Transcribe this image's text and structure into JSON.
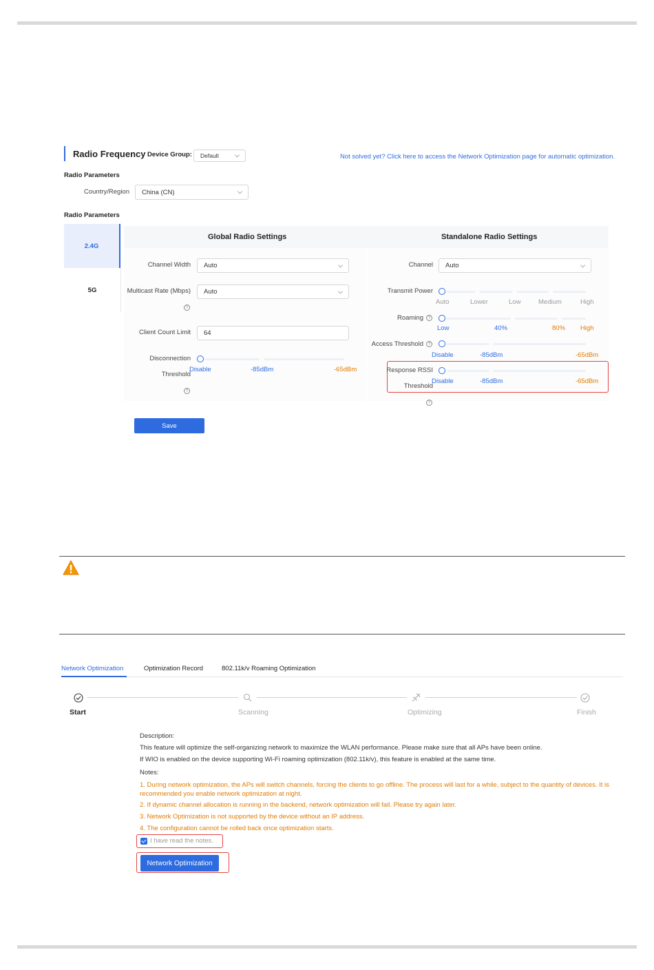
{
  "radio_frequency": {
    "title": "Radio Frequency",
    "device_group_label": "Device Group:",
    "device_group_value": "Default",
    "help_link": "Not solved yet? Click here to access the Network Optimization page for automatic optimization.",
    "section1_title": "Radio Parameters",
    "country_label": "Country/Region",
    "country_value": "China (CN)",
    "section2_title": "Radio Parameters",
    "band_tabs": [
      "2.4G",
      "5G"
    ],
    "active_band": "2.4G",
    "global_title": "Global Radio Settings",
    "standalone_title": "Standalone Radio Settings",
    "global": {
      "channel_width_label": "Channel Width",
      "channel_width_value": "Auto",
      "multicast_label": "Multicast Rate (Mbps)",
      "multicast_value": "Auto",
      "client_limit_label": "Client Count Limit",
      "client_limit_value": "64",
      "disconnect_label_1": "Disconnection",
      "disconnect_label_2": "Threshold",
      "disconnect_ticks": [
        "Disable",
        "-85dBm",
        "-65dBm"
      ]
    },
    "standalone": {
      "channel_label": "Channel",
      "channel_value": "Auto",
      "tx_power_label": "Transmit Power",
      "tx_power_ticks": [
        "Auto",
        "Lower",
        "Low",
        "Medium",
        "High"
      ],
      "roaming_label": "Roaming",
      "roaming_ticks": [
        "Low",
        "40%",
        "80%",
        "High"
      ],
      "access_label": "Access Threshold",
      "access_ticks": [
        "Disable",
        "-85dBm",
        "-65dBm"
      ],
      "rssi_label_1": "Response RSSI",
      "rssi_label_2": "Threshold",
      "rssi_ticks": [
        "Disable",
        "-85dBm",
        "-65dBm"
      ]
    },
    "save_label": "Save",
    "colors": {
      "accent": "#2e6bdf",
      "warning": "#e07b00",
      "highlight": "#e34343"
    }
  },
  "network_optimization": {
    "tabs": [
      "Network Optimization",
      "Optimization Record",
      "802.11k/v Roaming Optimization"
    ],
    "active_tab": "Network Optimization",
    "steps": [
      "Start",
      "Scanning",
      "Optimizing",
      "Finish"
    ],
    "active_step": "Start",
    "description_title": "Description:",
    "description_lines": [
      "This feature will optimize the self-organizing network to maximize the WLAN performance. Please make sure that all APs have been online.",
      "If WIO is enabled on the device supporting Wi-Fi roaming optimization (802.11k/v), this feature is enabled at the same time."
    ],
    "notes_title": "Notes:",
    "notes": [
      "1. During network optimization, the APs will switch channels, forcing the clients to go offline. The process will last for a while, subject to the quantity of devices. It is recommended you enable network optimization at night.",
      "2. If dynamic channel allocation is running in the backend, network optimization will fail. Please try again later.",
      "3. Network Optimization is not supported by the device without an IP address.",
      "4. The configuration cannot be rolled back once optimization starts."
    ],
    "checkbox_label": "I have read the notes.",
    "checkbox_checked": true,
    "button_label": "Network Optimization"
  }
}
